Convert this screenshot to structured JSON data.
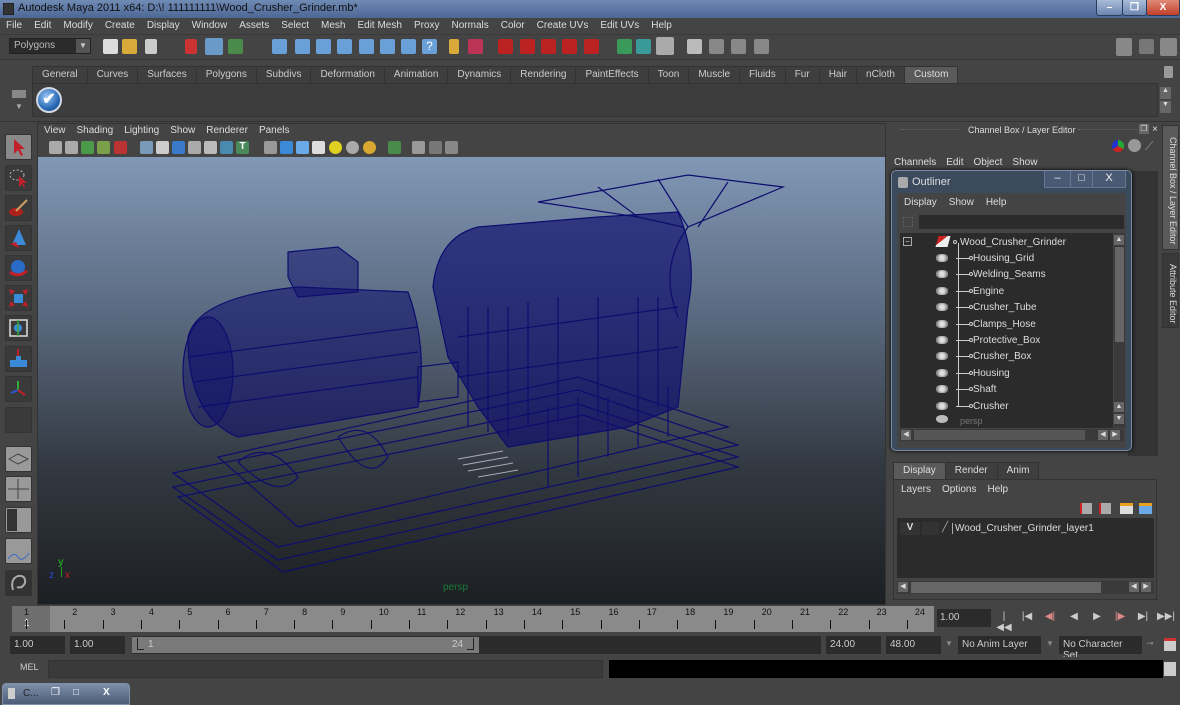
{
  "window": {
    "title": "Autodesk Maya 2011 x64: D:\\! 111111111\\Wood_Crusher_Grinder.mb*",
    "buttons": {
      "minimize": "–",
      "restore": "❐",
      "close": "X"
    }
  },
  "menubar": [
    "File",
    "Edit",
    "Modify",
    "Create",
    "Display",
    "Window",
    "Assets",
    "Select",
    "Mesh",
    "Edit Mesh",
    "Proxy",
    "Normals",
    "Color",
    "Create UVs",
    "Edit UVs",
    "Help"
  ],
  "statusline": {
    "mode": "Polygons"
  },
  "shelf": {
    "tabs": [
      "General",
      "Curves",
      "Surfaces",
      "Polygons",
      "Subdivs",
      "Deformation",
      "Animation",
      "Dynamics",
      "Rendering",
      "PaintEffects",
      "Toon",
      "Muscle",
      "Fluids",
      "Fur",
      "Hair",
      "nCloth",
      "Custom"
    ],
    "active_tab": "Custom",
    "button_glyph": "✔"
  },
  "toolbox": {
    "tools": [
      "select-tool",
      "lasso-tool",
      "paint-select-tool",
      "move-tool",
      "rotate-tool",
      "scale-tool",
      "universal-manipulator",
      "soft-mod-tool",
      "show-manipulator",
      "last-used-tool"
    ],
    "layouts": [
      "single-perspective",
      "four-view",
      "outliner-persp",
      "graph-persp",
      "maya-logo"
    ]
  },
  "viewport": {
    "menu": [
      "View",
      "Shading",
      "Lighting",
      "Show",
      "Renderer",
      "Panels"
    ],
    "camera_label": "persp",
    "axis": {
      "x": "x",
      "y": "y",
      "z": "z"
    }
  },
  "channelbox": {
    "title": "Channel Box / Layer Editor",
    "menu": [
      "Channels",
      "Edit",
      "Object",
      "Show"
    ]
  },
  "side_tabs": [
    "Channel Box / Layer Editor",
    "Attribute Editor"
  ],
  "outliner": {
    "title": "Outliner",
    "menu": [
      "Display",
      "Show",
      "Help"
    ],
    "search_value": "",
    "root": "Wood_Crusher_Grinder",
    "children": [
      "Housing_Grid",
      "Welding_Seams",
      "Engine",
      "Crusher_Tube",
      "Clamps_Hose",
      "Protective_Box",
      "Crusher_Box",
      "Housing",
      "Shaft",
      "Crusher"
    ],
    "partial_item": "persp"
  },
  "layer_editor": {
    "tabs": [
      "Display",
      "Render",
      "Anim"
    ],
    "active_tab": "Display",
    "menu": [
      "Layers",
      "Options",
      "Help"
    ],
    "layers": [
      {
        "visible": "V",
        "name": "Wood_Crusher_Grinder_layer1"
      }
    ]
  },
  "timeslider": {
    "frames": [
      "1",
      "2",
      "3",
      "4",
      "5",
      "6",
      "7",
      "8",
      "9",
      "10",
      "11",
      "12",
      "13",
      "14",
      "15",
      "16",
      "17",
      "18",
      "19",
      "20",
      "21",
      "22",
      "23",
      "24"
    ],
    "current_frame_marker": "1",
    "current_time": "1.00",
    "playback": [
      "|◀◀",
      "|◀",
      "◀|",
      "◀",
      "▶",
      "|▶",
      "▶|",
      "▶▶|"
    ]
  },
  "rangeslider": {
    "start_time": "1.00",
    "playback_start": "1.00",
    "range_start_label": "1",
    "range_end_label": "24",
    "playback_end": "24.00",
    "end_time": "48.00",
    "anim_layer": "No Anim Layer",
    "character_set": "No Character Set"
  },
  "commandline": {
    "label": "MEL",
    "input": "",
    "output": ""
  },
  "minimized_window": {
    "label": "C..."
  },
  "colors": {
    "wireframe": "#0d0d6e",
    "accent": "#5a5a5a",
    "titlebar": "#5a74a2"
  }
}
